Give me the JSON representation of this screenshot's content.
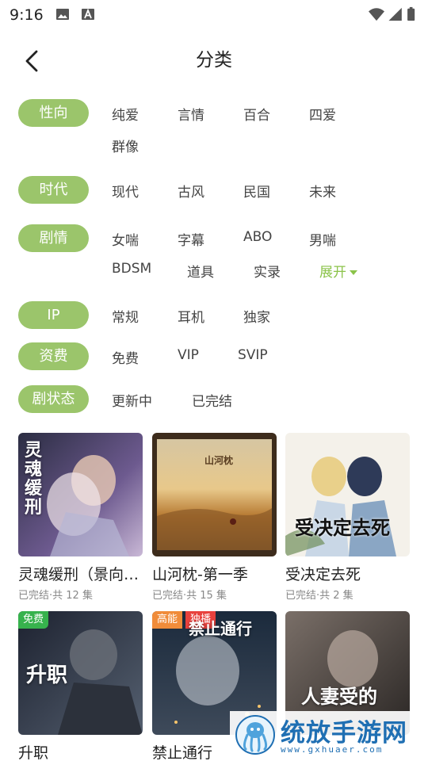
{
  "status_bar": {
    "time": "9:16"
  },
  "header": {
    "title": "分类"
  },
  "filters": [
    {
      "label": "性向",
      "options": [
        "纯爱",
        "言情",
        "百合",
        "四爱",
        "群像"
      ]
    },
    {
      "label": "时代",
      "options": [
        "现代",
        "古风",
        "民国",
        "未来"
      ]
    },
    {
      "label": "剧情",
      "options": [
        "女喘",
        "字幕",
        "ABO",
        "男喘",
        "BDSM",
        "道具",
        "实录"
      ],
      "expand": "展开"
    },
    {
      "label": "IP",
      "options": [
        "常规",
        "耳机",
        "独家"
      ]
    },
    {
      "label": "资费",
      "options": [
        "免费",
        "VIP",
        "SVIP"
      ]
    },
    {
      "label": "剧状态",
      "options": [
        "更新中",
        "已完结"
      ]
    }
  ],
  "cards": [
    {
      "title": "灵魂缓刑（景向…",
      "subtitle": "已完结·共 12 集",
      "cover_text": "灵魂缓刑"
    },
    {
      "title": "山河枕-第一季",
      "subtitle": "已完结·共 15 集",
      "cover_text": "山河枕"
    },
    {
      "title": "受决定去死",
      "subtitle": "已完结·共 2 集",
      "cover_text": "受决定去死"
    },
    {
      "title": "升职",
      "badges": [
        "免费"
      ],
      "cover_text": "升职"
    },
    {
      "title": "禁止通行",
      "badges": [
        "高能",
        "独播"
      ],
      "cover_text": "禁止通行"
    },
    {
      "title": "",
      "cover_text": "人妻受的"
    }
  ],
  "watermark": {
    "text": "统放手游网",
    "url": "www.gxhuaer.com"
  },
  "colors": {
    "accent": "#9bc56b",
    "expand": "#8bc34a",
    "free": "#37b24d",
    "hot": "#f08c3a",
    "exclusive": "#e8413d"
  }
}
